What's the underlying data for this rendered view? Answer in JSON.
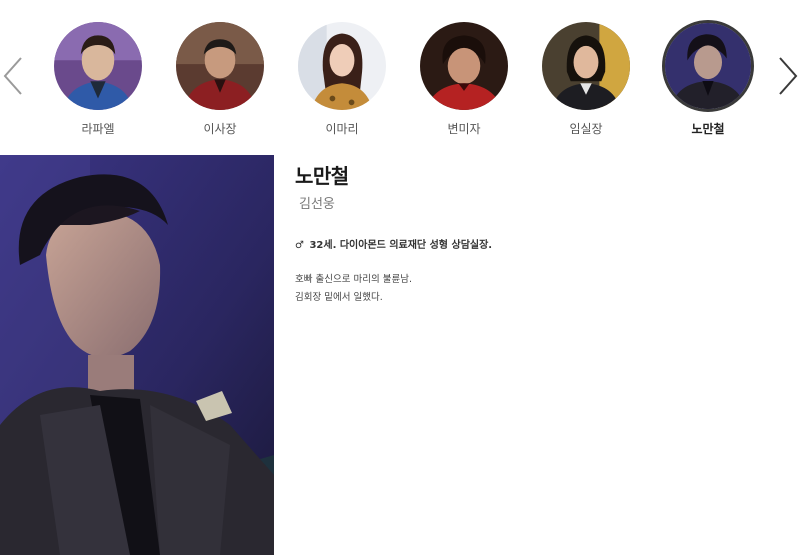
{
  "carousel": {
    "prev_icon": "chevron-left-icon",
    "next_icon": "chevron-right-icon",
    "characters": [
      {
        "name": "라파엘"
      },
      {
        "name": "이사장"
      },
      {
        "name": "이마리"
      },
      {
        "name": "변미자"
      },
      {
        "name": "임실장"
      },
      {
        "name": "노만철",
        "active": true
      }
    ]
  },
  "profile": {
    "title": "노만철",
    "actor": "김선웅",
    "gender_symbol": "♂",
    "summary": "32세. 다이아몬드 의료재단 성형 상담실장.",
    "description": [
      "호빠 출신으로 마리의 불륜남.",
      "김회장 밑에서 일했다."
    ]
  },
  "colors": {
    "active_ring": "#3a3a3a",
    "arrow": "#9a9a9a"
  }
}
